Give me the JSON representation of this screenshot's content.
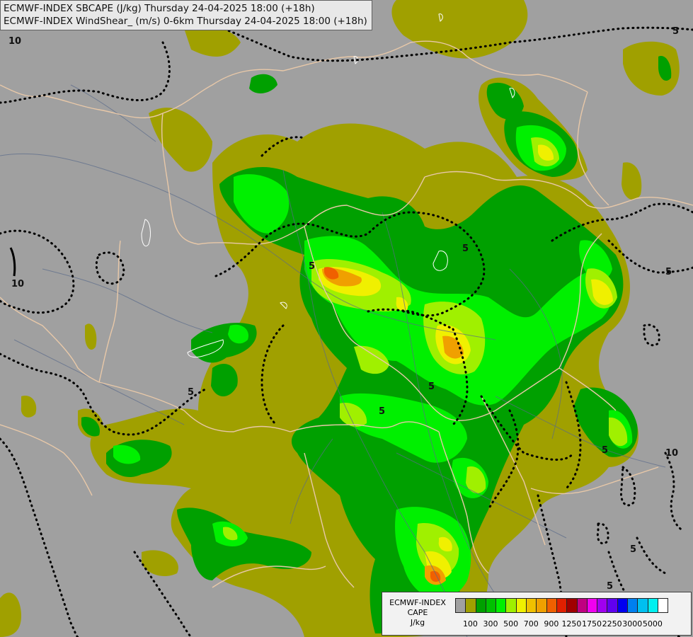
{
  "header": {
    "line1": "ECMWF-INDEX SBCAPE (J/kg) Thursday 24-04-2025 18:00 (+18h)",
    "line2": "ECMWF-INDEX WindShear_ (m/s) 0-6km Thursday 24-04-2025 18:00 (+18h)"
  },
  "legend": {
    "title_line1": "ECMWF-INDEX",
    "title_line2": "CAPE",
    "title_line3": "J/kg",
    "colors": [
      "#a0a0a0",
      "#a0a000",
      "#00a000",
      "#00c000",
      "#00f000",
      "#a0f000",
      "#f0f000",
      "#f0c000",
      "#f0a000",
      "#f06000",
      "#e02000",
      "#a00000",
      "#c00080",
      "#f000f0",
      "#a000f0",
      "#6000f0",
      "#0000f0",
      "#0080f0",
      "#00c0f0",
      "#00f0f0",
      "#ffffff"
    ],
    "labels": [
      "100",
      "300",
      "500",
      "700",
      "900",
      "1250",
      "1750",
      "2250",
      "3000",
      "5000"
    ]
  },
  "contour_labels": [
    "5",
    "5",
    "5",
    "5",
    "5",
    "5",
    "5",
    "5",
    "5",
    "5",
    "10",
    "10",
    "10"
  ]
}
